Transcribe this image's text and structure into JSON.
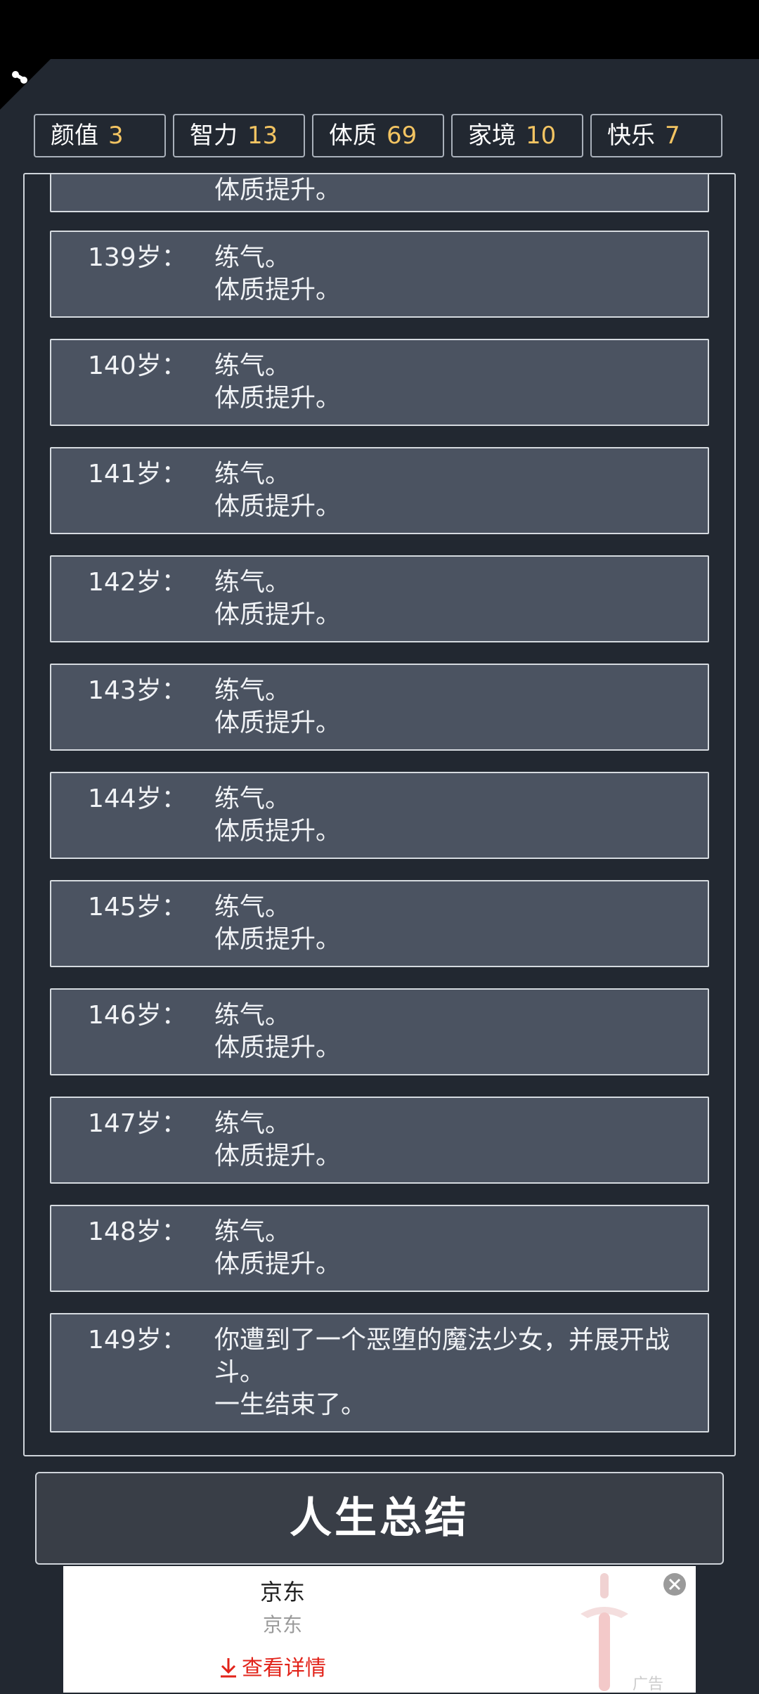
{
  "stats": [
    {
      "label": "颜值",
      "value": "3"
    },
    {
      "label": "智力",
      "value": "13"
    },
    {
      "label": "体质",
      "value": "69"
    },
    {
      "label": "家境",
      "value": "10"
    },
    {
      "label": "快乐",
      "value": "7"
    }
  ],
  "log": [
    {
      "age": "",
      "lines": [
        "体质提升。"
      ]
    },
    {
      "age": "139岁：",
      "lines": [
        "练气。",
        "体质提升。"
      ]
    },
    {
      "age": "140岁：",
      "lines": [
        "练气。",
        "体质提升。"
      ]
    },
    {
      "age": "141岁：",
      "lines": [
        "练气。",
        "体质提升。"
      ]
    },
    {
      "age": "142岁：",
      "lines": [
        "练气。",
        "体质提升。"
      ]
    },
    {
      "age": "143岁：",
      "lines": [
        "练气。",
        "体质提升。"
      ]
    },
    {
      "age": "144岁：",
      "lines": [
        "练气。",
        "体质提升。"
      ]
    },
    {
      "age": "145岁：",
      "lines": [
        "练气。",
        "体质提升。"
      ]
    },
    {
      "age": "146岁：",
      "lines": [
        "练气。",
        "体质提升。"
      ]
    },
    {
      "age": "147岁：",
      "lines": [
        "练气。",
        "体质提升。"
      ]
    },
    {
      "age": "148岁：",
      "lines": [
        "练气。",
        "体质提升。"
      ]
    },
    {
      "age": "149岁：",
      "lines": [
        "你遭到了一个恶堕的魔法少女，并展开战斗。",
        "一生结束了。"
      ]
    }
  ],
  "summary_button": "人生总结",
  "ad": {
    "title": "京东",
    "subtitle": "京东",
    "cta": "查看详情",
    "mark": "广告"
  },
  "colors": {
    "background": "#222831",
    "entry_bg": "#4b5361",
    "stat_value": "#f3c462",
    "cta": "#e2231a"
  }
}
